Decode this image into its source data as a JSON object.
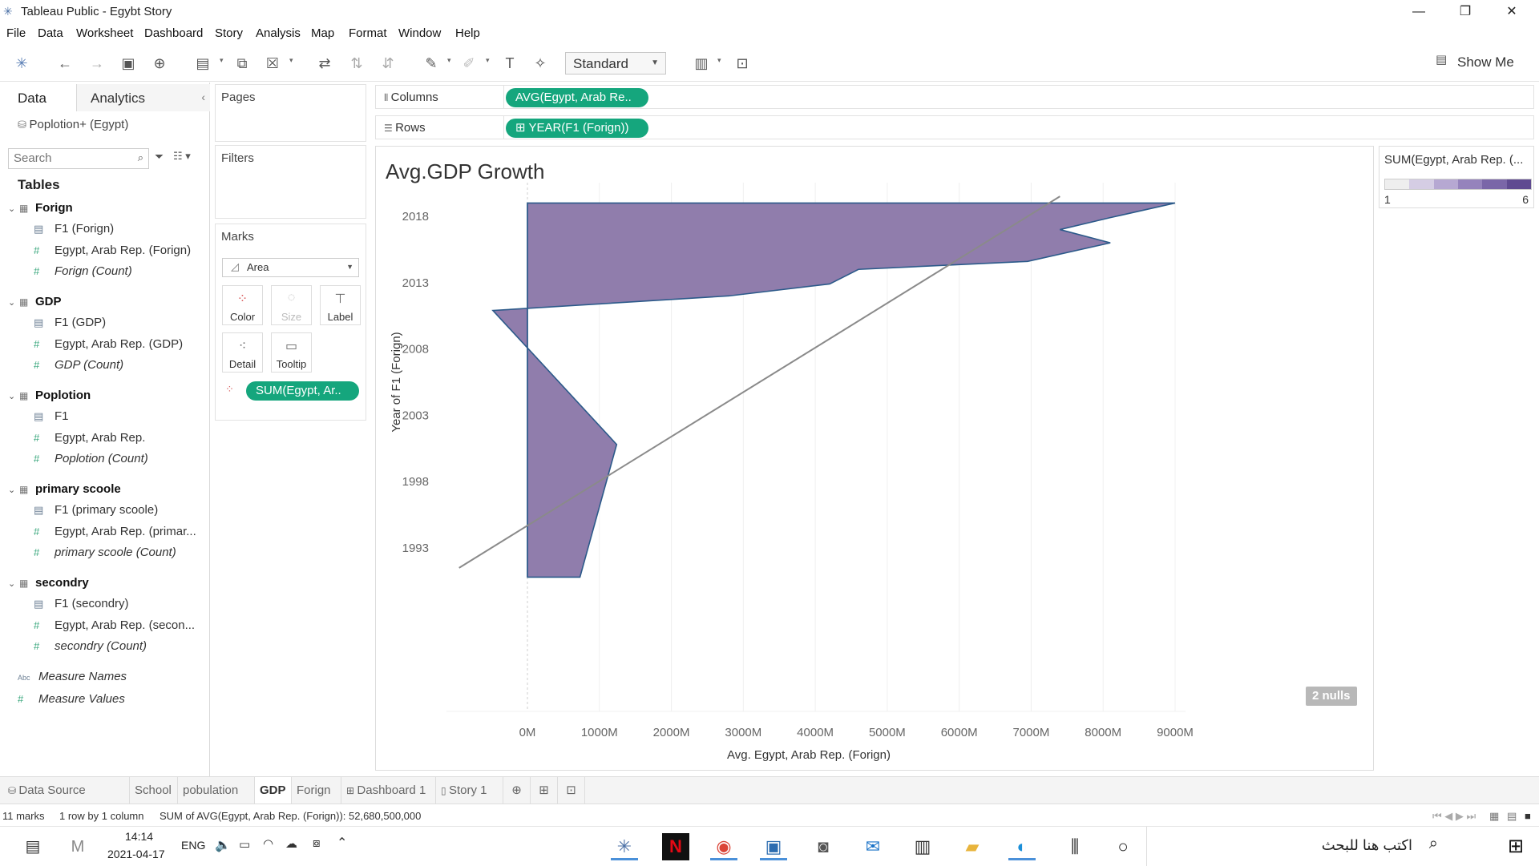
{
  "window": {
    "title": "Tableau Public - Egybt Story",
    "minimize": "—",
    "restore": "❐",
    "close": "✕"
  },
  "menu": [
    "File",
    "Data",
    "Worksheet",
    "Dashboard",
    "Story",
    "Analysis",
    "Map",
    "Format",
    "Window",
    "Help"
  ],
  "toolbar": {
    "fit": "Standard",
    "show_me": "Show Me"
  },
  "data_pane": {
    "tab_data": "Data",
    "tab_analytics": "Analytics",
    "datasource": "Poplotion+ (Egypt)",
    "search_placeholder": "Search",
    "tables_heading": "Tables",
    "tables": [
      {
        "name": "Forign",
        "fields": [
          {
            "name": "F1 (Forign)",
            "kind": "dim"
          },
          {
            "name": "Egypt, Arab Rep. (Forign)",
            "kind": "mea"
          },
          {
            "name": "Forign (Count)",
            "kind": "cnt"
          }
        ]
      },
      {
        "name": "GDP",
        "fields": [
          {
            "name": "F1 (GDP)",
            "kind": "dim"
          },
          {
            "name": "Egypt, Arab Rep. (GDP)",
            "kind": "mea"
          },
          {
            "name": "GDP (Count)",
            "kind": "cnt"
          }
        ]
      },
      {
        "name": "Poplotion",
        "fields": [
          {
            "name": "F1",
            "kind": "dim"
          },
          {
            "name": "Egypt, Arab Rep.",
            "kind": "mea"
          },
          {
            "name": "Poplotion (Count)",
            "kind": "cnt"
          }
        ]
      },
      {
        "name": "primary scoole",
        "fields": [
          {
            "name": "F1 (primary scoole)",
            "kind": "dim"
          },
          {
            "name": "Egypt, Arab Rep. (primar...",
            "kind": "mea"
          },
          {
            "name": "primary scoole (Count)",
            "kind": "cnt"
          }
        ]
      },
      {
        "name": "secondry",
        "fields": [
          {
            "name": "F1 (secondry)",
            "kind": "dim"
          },
          {
            "name": "Egypt, Arab Rep. (secon...",
            "kind": "mea"
          },
          {
            "name": "secondry (Count)",
            "kind": "cnt"
          }
        ]
      }
    ],
    "measure_names": "Measure Names",
    "measure_values": "Measure Values"
  },
  "cards": {
    "pages": "Pages",
    "filters": "Filters",
    "marks": "Marks",
    "mark_type": "Area",
    "color": "Color",
    "size": "Size",
    "label": "Label",
    "detail": "Detail",
    "tooltip": "Tooltip",
    "color_pill": "SUM(Egypt, Ar.."
  },
  "shelves": {
    "columns_label": "Columns",
    "columns_pill": "AVG(Egypt, Arab Re..",
    "rows_label": "Rows",
    "rows_pill": "⊞ YEAR(F1 (Forign))"
  },
  "view": {
    "title": "Avg.GDP Growth",
    "nulls": "2 nulls"
  },
  "legend": {
    "title": "SUM(Egypt, Arab Rep. (...",
    "min": "1",
    "max": "6",
    "colors": [
      "#eeeeee",
      "#d5cde4",
      "#b6a8d2",
      "#9583bc",
      "#7a66a8",
      "#5f4a91"
    ]
  },
  "chart_data": {
    "type": "area",
    "title": "Avg.GDP Growth",
    "xlabel": "Avg. Egypt, Arab Rep. (Forign)",
    "ylabel": "Year of F1 (Forign)",
    "x_ticks": [
      "0M",
      "1000M",
      "2000M",
      "3000M",
      "4000M",
      "5000M",
      "6000M",
      "7000M",
      "8000M",
      "9000M"
    ],
    "y_ticks": [
      "2018",
      "2013",
      "2008",
      "2003",
      "1998",
      "1993"
    ],
    "xlim": [
      -900,
      9400
    ],
    "ylim": [
      1990,
      2019.7
    ],
    "series": [
      {
        "name": "Avg. Egypt, Arab Rep. (Forign)",
        "values": [
          {
            "year": 1990.8,
            "value": 730
          },
          {
            "year": 2000.8,
            "value": 1240
          },
          {
            "year": 2010.9,
            "value": -480
          },
          {
            "year": 2012.0,
            "value": 2800
          },
          {
            "year": 2012.9,
            "value": 4200
          },
          {
            "year": 2014.0,
            "value": 4600
          },
          {
            "year": 2014.6,
            "value": 6950
          },
          {
            "year": 2016.0,
            "value": 8100
          },
          {
            "year": 2017.0,
            "value": 7400
          },
          {
            "year": 2017.9,
            "value": 8100
          },
          {
            "year": 2019.0,
            "value": 9000
          }
        ]
      }
    ],
    "trend_line": {
      "from": {
        "value": -950,
        "year": 1991.5
      },
      "to": {
        "value": 7400,
        "year": 2019.5
      }
    },
    "color": "#8a76a8",
    "stroke": "#2c5a8a",
    "grid": "vertical"
  },
  "sheet_tabs": [
    "Data Source",
    "School",
    "pobulation",
    "GDP",
    "Forign",
    "Dashboard 1",
    "Story 1"
  ],
  "active_tab": "GDP",
  "status": {
    "marks": "11 marks",
    "rows": "1 row by 1 column",
    "sum": "SUM of AVG(Egypt, Arab Rep. (Forign)): 52,680,500,000"
  },
  "taskbar": {
    "time": "14:14",
    "date": "2021-04-17",
    "lang": "ENG",
    "search_placeholder": "اكتب هنا للبحث"
  }
}
